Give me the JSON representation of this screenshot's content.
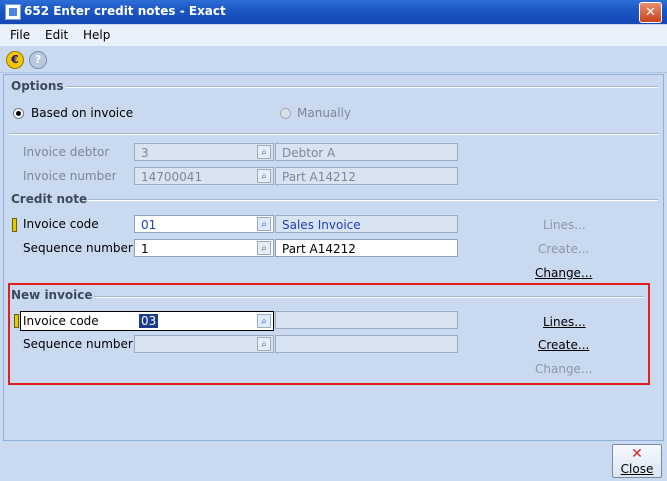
{
  "window": {
    "title": "652 Enter credit notes - Exact",
    "close_glyph": "✕"
  },
  "menu": {
    "file": "File",
    "edit": "Edit",
    "help": "Help"
  },
  "toolbar": {
    "icons": [
      "exact-e-icon",
      "help-icon"
    ]
  },
  "options": {
    "heading": "Options",
    "based_on_invoice": "Based on invoice",
    "manually": "Manually",
    "selected": "Based on invoice"
  },
  "invoice_info": {
    "debtor_label": "Invoice debtor",
    "debtor_value": "3",
    "debtor_name": "Debtor A",
    "number_label": "Invoice number",
    "number_value": "14700041",
    "number_desc": "Part A14212"
  },
  "credit_note": {
    "heading": "Credit note",
    "code_label": "Invoice code",
    "code_value": "01",
    "code_desc": "Sales Invoice",
    "seq_label": "Sequence number",
    "seq_value": "1",
    "seq_desc": "Part A14212",
    "lines_link": "Lines...",
    "create_link": "Create...",
    "change_link": "Change..."
  },
  "new_invoice": {
    "heading": "New invoice",
    "code_label": "Invoice code",
    "code_value": "03",
    "seq_label": "Sequence number",
    "lines_link": "Lines...",
    "create_link": "Create...",
    "change_link": "Change..."
  },
  "footer": {
    "close_label": "Close",
    "close_glyph": "✕"
  },
  "colors": {
    "highlight_border": "#e0201e",
    "title_bar": "#1b57c4",
    "link_blue_text": "#1e3fbf"
  }
}
